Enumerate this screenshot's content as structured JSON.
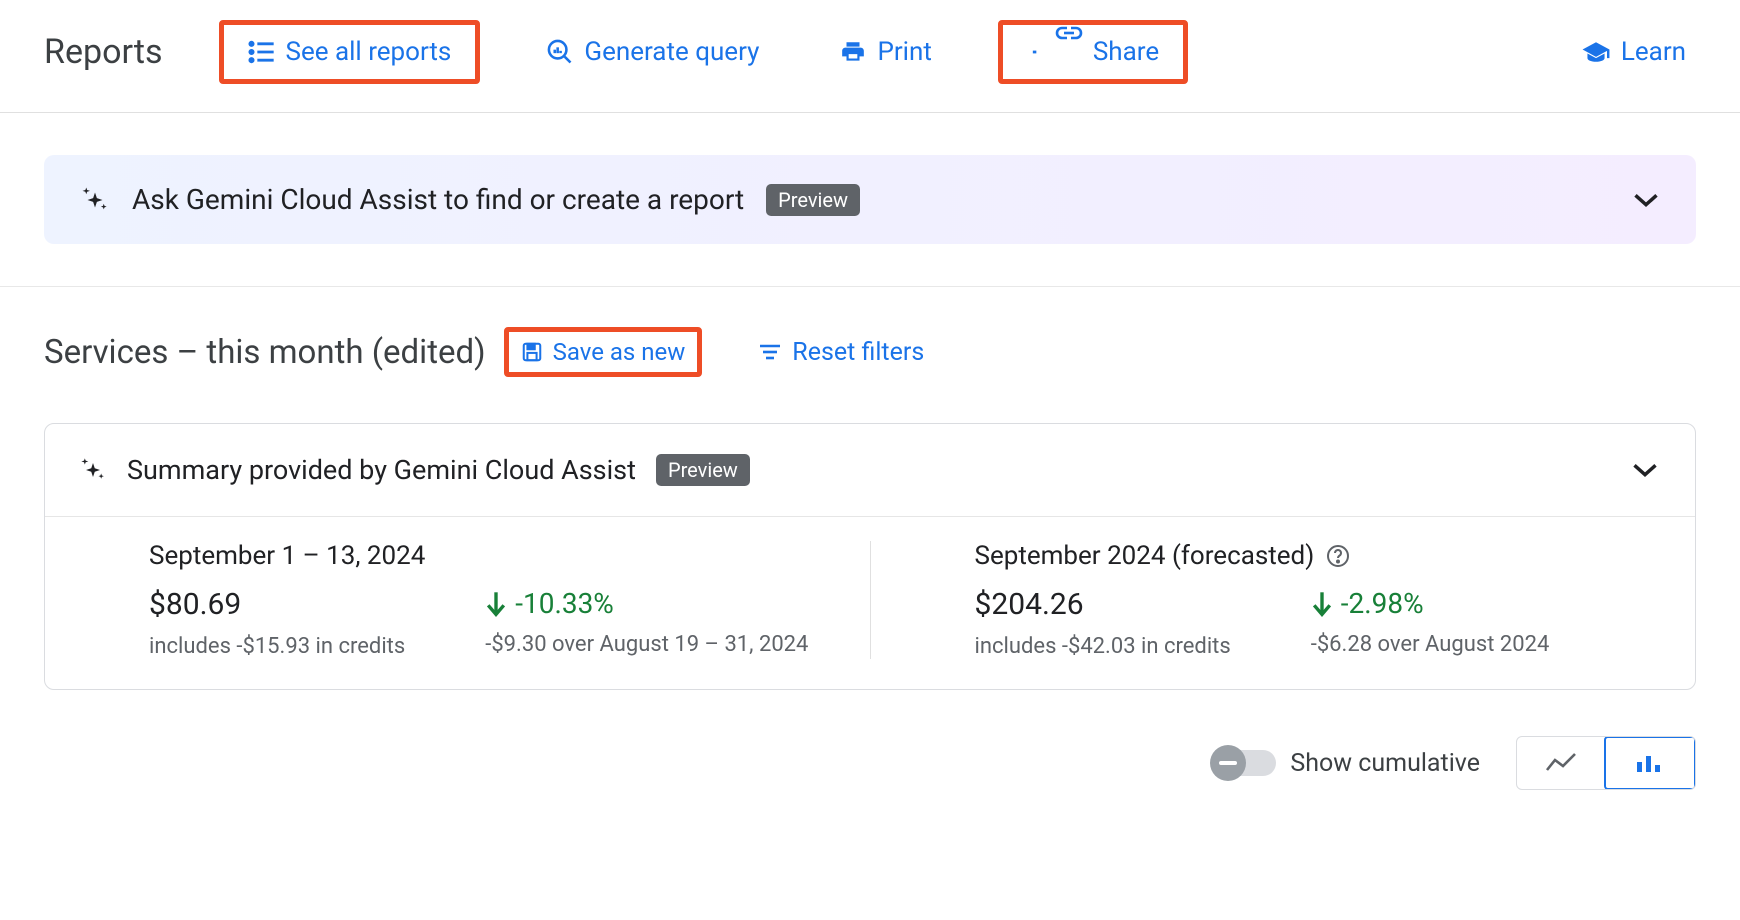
{
  "header": {
    "title": "Reports",
    "actions": {
      "see_all": "See all reports",
      "generate_query": "Generate query",
      "print": "Print",
      "share": "Share",
      "learn": "Learn"
    }
  },
  "gemini_banner": {
    "text": "Ask Gemini Cloud Assist to find or create a report",
    "badge": "Preview"
  },
  "report": {
    "title": "Services – this month (edited)",
    "save_as_new": "Save as new",
    "reset_filters": "Reset filters"
  },
  "summary": {
    "title": "Summary provided by Gemini Cloud Assist",
    "badge": "Preview",
    "left": {
      "period": "September 1 – 13, 2024",
      "amount": "$80.69",
      "credits": "includes -$15.93 in credits",
      "delta_pct": "-10.33%",
      "delta_detail": "-$9.30 over August 19 – 31, 2024"
    },
    "right": {
      "period": "September 2024 (forecasted)",
      "amount": "$204.26",
      "credits": "includes -$42.03 in credits",
      "delta_pct": "-2.98%",
      "delta_detail": "-$6.28 over August 2024"
    }
  },
  "controls": {
    "show_cumulative": "Show cumulative"
  },
  "colors": {
    "link": "#1a73e8",
    "green": "#188038",
    "highlight": "#ee4d26"
  }
}
